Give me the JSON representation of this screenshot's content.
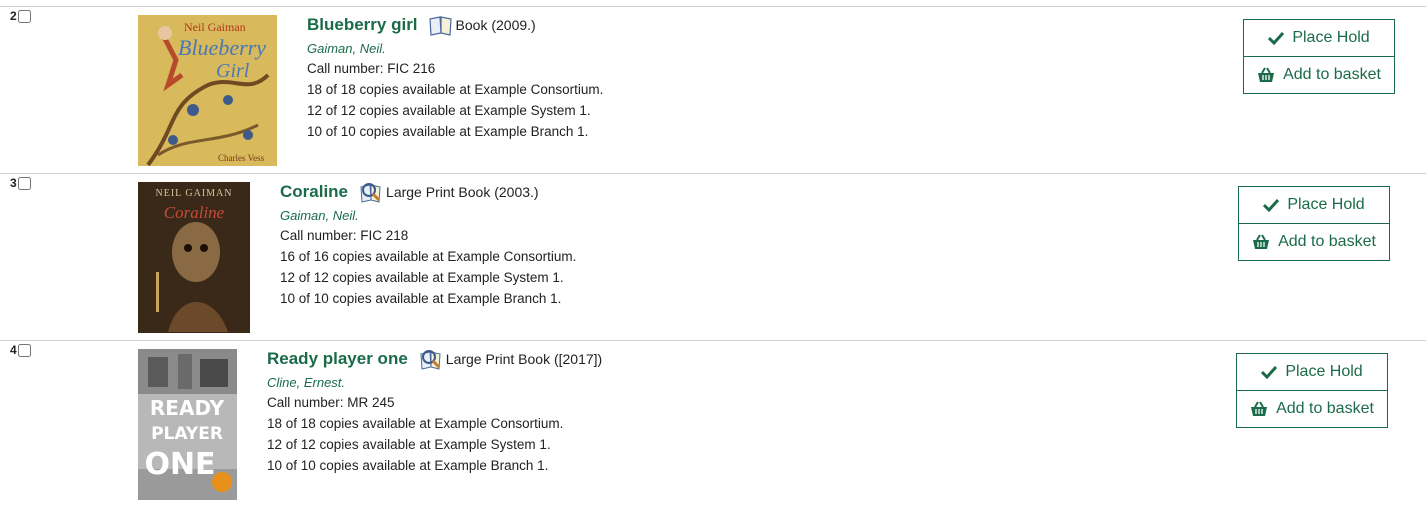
{
  "results": [
    {
      "number": "2",
      "title": "Blueberry girl",
      "format": "Book (2009.)",
      "format_icon": "book-icon",
      "author": "Gaiman, Neil.",
      "call_number": "Call number: FIC 216",
      "availability": [
        "18 of 18 copies available at Example Consortium.",
        "12 of 12 copies available at Example System 1.",
        "10 of 10 copies available at Example Branch 1."
      ],
      "cover_lettering": [
        "Neil Gaiman",
        "Blueberry",
        "Girl",
        "Charles Vess"
      ],
      "place_hold_label": "Place Hold",
      "add_basket_label": "Add to basket"
    },
    {
      "number": "3",
      "title": "Coraline",
      "format": "Large Print Book (2003.)",
      "format_icon": "large-print-icon",
      "author": "Gaiman, Neil.",
      "call_number": "Call number: FIC 218",
      "availability": [
        "16 of 16 copies available at Example Consortium.",
        "12 of 12 copies available at Example System 1.",
        "10 of 10 copies available at Example Branch 1."
      ],
      "cover_lettering": [
        "NEIL GAIMAN",
        "Coraline"
      ],
      "place_hold_label": "Place Hold",
      "add_basket_label": "Add to basket"
    },
    {
      "number": "4",
      "title": "Ready player one",
      "format": "Large Print Book ([2017])",
      "format_icon": "large-print-icon",
      "author": "Cline, Ernest.",
      "call_number": "Call number: MR 245",
      "availability": [
        "18 of 18 copies available at Example Consortium.",
        "12 of 12 copies available at Example System 1.",
        "10 of 10 copies available at Example Branch 1."
      ],
      "cover_lettering": [
        "READY",
        "PLAYER",
        "ONE"
      ],
      "place_hold_label": "Place Hold",
      "add_basket_label": "Add to basket"
    }
  ],
  "colors": {
    "accent": "#1b6b4a",
    "divider": "#cfcfcf"
  }
}
